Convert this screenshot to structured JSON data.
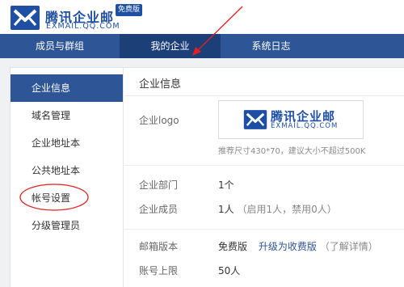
{
  "header": {
    "brand_name": "腾讯企业邮",
    "brand_sub": "EXMAIL.QQ.COM",
    "badge": "免费版"
  },
  "nav": {
    "items": [
      {
        "label": "成员与群组"
      },
      {
        "label": "我的企业"
      },
      {
        "label": "系统日志"
      }
    ],
    "active_index": 1
  },
  "sidebar": {
    "items": [
      {
        "label": "企业信息"
      },
      {
        "label": "域名管理"
      },
      {
        "label": "企业地址本"
      },
      {
        "label": "公共地址本"
      },
      {
        "label": "帐号设置"
      },
      {
        "label": "分级管理员"
      }
    ],
    "active_index": 0
  },
  "main": {
    "title": "企业信息",
    "logo_label": "企业logo",
    "logo_brand_name": "腾讯企业邮",
    "logo_brand_sub": "EXMAIL.QQ.COM",
    "logo_hint": "推荐尺寸430*70，建议大小不超过500K",
    "dept_label": "企业部门",
    "dept_value": "1个",
    "members_label": "企业成员",
    "members_value": "1人",
    "members_detail": "（启用1人，禁用0人）",
    "edition_label": "邮箱版本",
    "edition_value": "免费版",
    "edition_upgrade": "升级为收费版",
    "edition_more": "（了解详情）",
    "limit_label": "账号上限",
    "limit_value": "50人"
  },
  "colors": {
    "brand": "#1e4fa3",
    "nav_bg": "#2e5596",
    "nav_active": "#1d3f78",
    "annotation_red": "#e02020"
  }
}
